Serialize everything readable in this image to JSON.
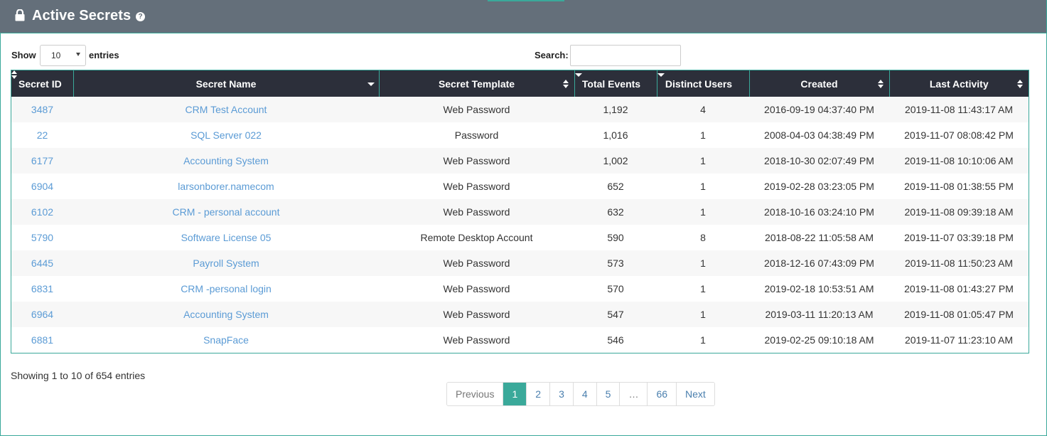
{
  "header": {
    "title": "Active Secrets",
    "help_glyph": "?"
  },
  "controls": {
    "show_label": "Show",
    "entries_value": "10",
    "entries_label": "entries",
    "search_label": "Search:",
    "search_value": ""
  },
  "table": {
    "columns": [
      "Secret ID",
      "Secret Name",
      "Secret Template",
      "Total Events",
      "Distinct Users",
      "Created",
      "Last Activity"
    ],
    "rows": [
      [
        "3487",
        "CRM Test Account",
        "Web Password",
        "1,192",
        "4",
        "2016-09-19 04:37:40 PM",
        "2019-11-08 11:43:17 AM"
      ],
      [
        "22",
        "SQL Server 022",
        "Password",
        "1,016",
        "1",
        "2008-04-03 04:38:49 PM",
        "2019-11-07 08:08:42 PM"
      ],
      [
        "6177",
        "Accounting System",
        "Web Password",
        "1,002",
        "1",
        "2018-10-30 02:07:49 PM",
        "2019-11-08 10:10:06 AM"
      ],
      [
        "6904",
        "larsonborer.namecom",
        "Web Password",
        "652",
        "1",
        "2019-02-28 03:23:05 PM",
        "2019-11-08 01:38:55 PM"
      ],
      [
        "6102",
        "CRM - personal account",
        "Web Password",
        "632",
        "1",
        "2018-10-16 03:24:10 PM",
        "2019-11-08 09:39:18 AM"
      ],
      [
        "5790",
        "Software License 05",
        "Remote Desktop Account",
        "590",
        "8",
        "2018-08-22 11:05:58 AM",
        "2019-11-07 03:39:18 PM"
      ],
      [
        "6445",
        "Payroll System",
        "Web Password",
        "573",
        "1",
        "2018-12-16 07:43:09 PM",
        "2019-11-08 11:50:23 AM"
      ],
      [
        "6831",
        "CRM -personal login",
        "Web Password",
        "570",
        "1",
        "2019-02-18 10:53:51 AM",
        "2019-11-08 01:43:27 PM"
      ],
      [
        "6964",
        "Accounting System",
        "Web Password",
        "547",
        "1",
        "2019-03-11 11:20:13 AM",
        "2019-11-08 01:05:47 PM"
      ],
      [
        "6881",
        "SnapFace",
        "Web Password",
        "546",
        "1",
        "2019-02-25 09:10:18 AM",
        "2019-11-07 11:23:10 AM"
      ]
    ]
  },
  "footer": {
    "info": "Showing 1 to 10 of 654 entries",
    "pagination": [
      "Previous",
      "1",
      "2",
      "3",
      "4",
      "5",
      "…",
      "66",
      "Next"
    ],
    "active_page": "1"
  },
  "colors": {
    "header_bg": "#646f7a",
    "table_head_bg": "#2c2f3a",
    "accent": "#3aa99a",
    "link": "#5b9bd5"
  }
}
